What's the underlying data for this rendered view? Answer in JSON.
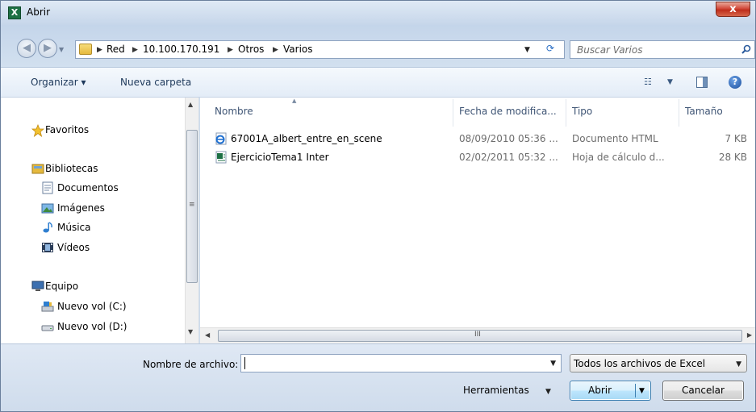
{
  "window": {
    "title": "Abrir",
    "app_icon": "X",
    "close_label": "x"
  },
  "address": {
    "breadcrumbs": [
      "Red",
      "10.100.170.191",
      "Otros",
      "Varios"
    ],
    "search_placeholder": "Buscar Varios"
  },
  "toolbar": {
    "organize_label": "Organizar ▾",
    "new_folder_label": "Nueva carpeta"
  },
  "nav": {
    "items": [
      {
        "label": "Favoritos",
        "icon": "star-icon"
      },
      {
        "label": "Bibliotecas",
        "icon": "libraries-icon"
      },
      {
        "label": "Documentos",
        "icon": "documents-icon"
      },
      {
        "label": "Imágenes",
        "icon": "pictures-icon"
      },
      {
        "label": "Música",
        "icon": "music-icon"
      },
      {
        "label": "Vídeos",
        "icon": "videos-icon"
      },
      {
        "label": "Equipo",
        "icon": "computer-icon"
      },
      {
        "label": "Nuevo vol (C:)",
        "icon": "drive-c-icon"
      },
      {
        "label": "Nuevo vol (D:)",
        "icon": "drive-d-icon"
      }
    ]
  },
  "files": {
    "columns": [
      "Nombre",
      "Fecha de modifica...",
      "Tipo",
      "Tamaño"
    ],
    "rows": [
      {
        "name": "67001A_albert_entre_en_scene",
        "date": "08/09/2010 05:36 ...",
        "type": "Documento HTML",
        "size": "7 KB",
        "icon": "html-document-icon"
      },
      {
        "name": "EjercicioTema1 Inter",
        "date": "02/02/2011 05:32 ...",
        "type": "Hoja de cálculo d...",
        "size": "28 KB",
        "icon": "excel-sheet-icon"
      }
    ]
  },
  "bottom": {
    "filename_label": "Nombre de archivo:",
    "filename_value": "",
    "filter_label": "Todos los archivos de Excel",
    "tools_label": "Herramientas",
    "open_label": "Abrir",
    "cancel_label": "Cancelar"
  },
  "colors": {
    "accent": "#3c7fb1",
    "close_red": "#c8402c",
    "chrome_bg": "#cfdcec"
  }
}
